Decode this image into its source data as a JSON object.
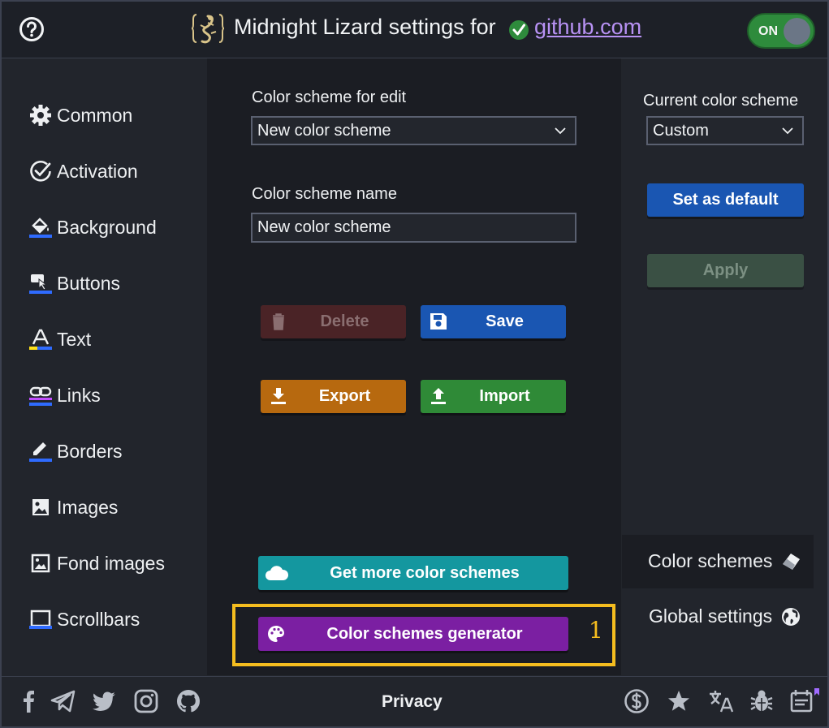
{
  "header": {
    "title": "Midnight Lizard settings for",
    "site": "github.com",
    "toggle_label": "ON"
  },
  "sidebar": {
    "items": [
      {
        "label": "Common",
        "icon": "gear-icon"
      },
      {
        "label": "Activation",
        "icon": "check-circle-icon"
      },
      {
        "label": "Background",
        "icon": "paint-bucket-icon"
      },
      {
        "label": "Buttons",
        "icon": "pointer-hand-icon"
      },
      {
        "label": "Text",
        "icon": "text-a-icon"
      },
      {
        "label": "Links",
        "icon": "link-icon"
      },
      {
        "label": "Borders",
        "icon": "pencil-icon"
      },
      {
        "label": "Images",
        "icon": "image-icon"
      },
      {
        "label": "Fond images",
        "icon": "wallpaper-icon"
      },
      {
        "label": "Scrollbars",
        "icon": "window-icon"
      }
    ]
  },
  "main": {
    "scheme_for_edit_label": "Color scheme for edit",
    "scheme_for_edit_value": "New color scheme",
    "scheme_name_label": "Color scheme name",
    "scheme_name_value": "New color scheme",
    "buttons": {
      "delete": "Delete",
      "save": "Save",
      "export": "Export",
      "import": "Import",
      "get_more": "Get more color schemes",
      "generator": "Color schemes generator"
    }
  },
  "right": {
    "current_label": "Current color scheme",
    "current_value": "Custom",
    "set_default": "Set as default",
    "apply": "Apply",
    "tabs": [
      {
        "label": "Color schemes",
        "icon": "eraser-icon"
      },
      {
        "label": "Global settings",
        "icon": "globe-icon"
      }
    ]
  },
  "footer": {
    "privacy": "Privacy"
  },
  "annotation": {
    "marker": "1"
  },
  "colors": {
    "accent_purple": "#7b1fa2",
    "teal": "#14979f",
    "save_blue": "#1a56b2",
    "export_orange": "#b7690f",
    "import_green": "#2f8a37",
    "highlight": "#f5bd1f"
  }
}
